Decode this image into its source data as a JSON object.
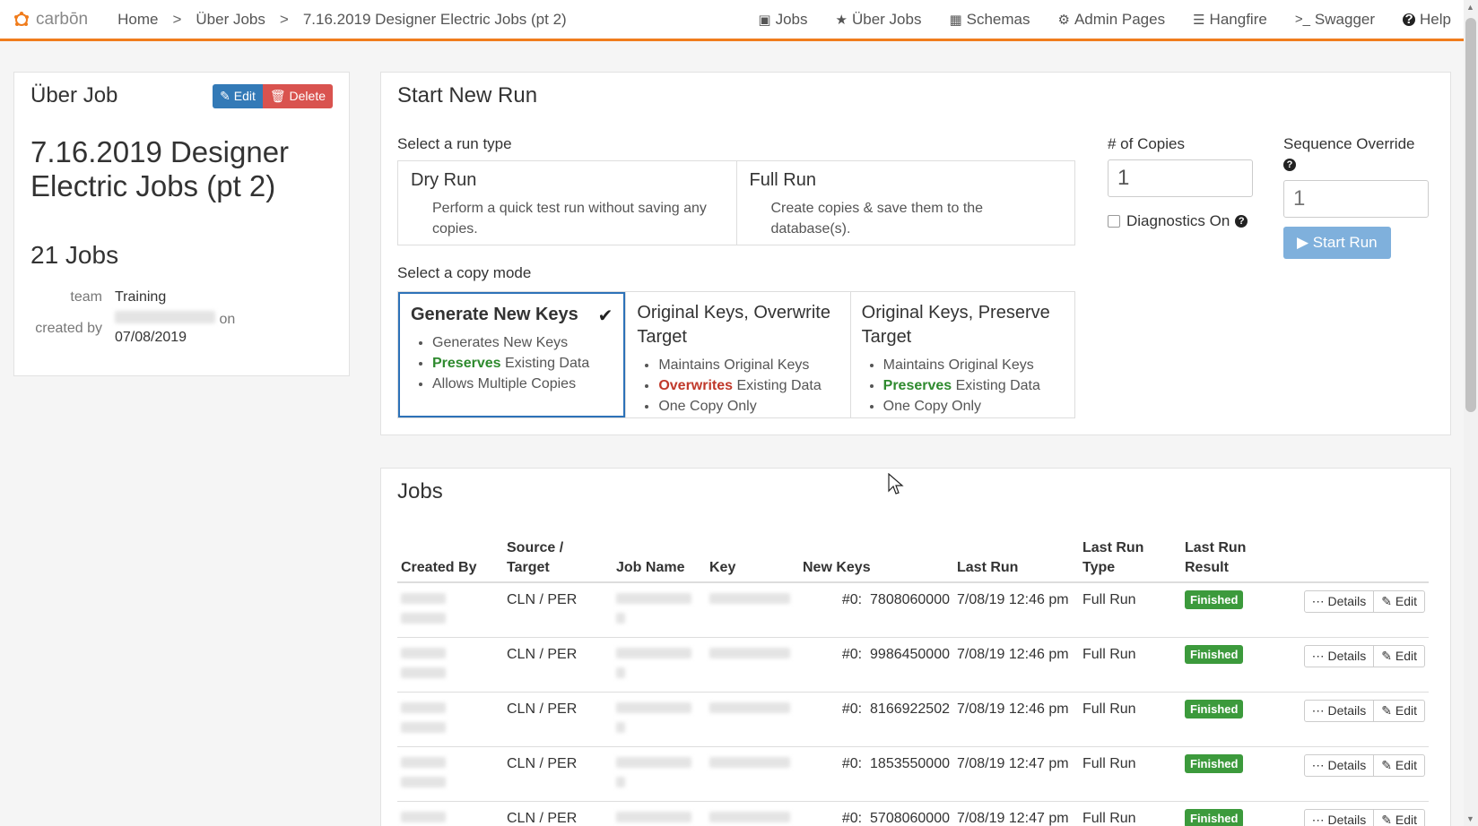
{
  "brand": {
    "name": "carbōn",
    "color": "#f07c1c"
  },
  "breadcrumb": {
    "home": "Home",
    "sep1": ">",
    "uber_jobs": "Über Jobs",
    "sep2": ">",
    "current": "7.16.2019 Designer Electric Jobs (pt 2)"
  },
  "nav": {
    "jobs": "Jobs",
    "uber_jobs": "Über Jobs",
    "schemas": "Schemas",
    "admin_pages": "Admin Pages",
    "hangfire": "Hangfire",
    "swagger_prefix": ">_",
    "swagger": "Swagger",
    "help": "Help"
  },
  "uber_job": {
    "heading": "Über Job",
    "edit_label": "Edit",
    "delete_label": "Delete",
    "title": "7.16.2019 Designer Electric Jobs (pt 2)",
    "jobs_count": "21 Jobs",
    "team_label": "team",
    "team_value": "Training",
    "created_by_label": "created by",
    "on_label": "on",
    "created_date": "07/08/2019"
  },
  "start_run": {
    "heading": "Start New Run",
    "run_type_label": "Select a run type",
    "run_types": [
      {
        "title": "Dry Run",
        "desc": "Perform a quick test run without saving any copies."
      },
      {
        "title": "Full Run",
        "desc": "Create copies & save them to the database(s)."
      }
    ],
    "copy_mode_label": "Select a copy mode",
    "copy_modes": [
      {
        "title": "Generate New Keys",
        "selected": true,
        "items": [
          {
            "pre": "",
            "hl": "",
            "post": "Generates New Keys"
          },
          {
            "pre": "",
            "hl": "Preserves",
            "post": " Existing Data",
            "hl_color": "green"
          },
          {
            "pre": "",
            "hl": "",
            "post": "Allows Multiple Copies"
          }
        ]
      },
      {
        "title": "Original Keys, Overwrite Target",
        "selected": false,
        "items": [
          {
            "pre": "",
            "hl": "",
            "post": "Maintains Original Keys"
          },
          {
            "pre": "",
            "hl": "Overwrites",
            "post": " Existing Data",
            "hl_color": "red"
          },
          {
            "pre": "",
            "hl": "",
            "post": "One Copy Only"
          }
        ]
      },
      {
        "title": "Original Keys, Preserve Target",
        "selected": false,
        "items": [
          {
            "pre": "",
            "hl": "",
            "post": "Maintains Original Keys"
          },
          {
            "pre": "",
            "hl": "Preserves",
            "post": " Existing Data",
            "hl_color": "green"
          },
          {
            "pre": "",
            "hl": "",
            "post": "One Copy Only"
          }
        ]
      }
    ],
    "copies_label": "# of Copies",
    "copies_value": "1",
    "diagnostics_label": "Diagnostics On",
    "sequence_label": "Sequence Override",
    "sequence_placeholder": "1",
    "start_button": "Start Run"
  },
  "jobs": {
    "heading": "Jobs",
    "columns": [
      "Created By",
      "Source / Target",
      "Job Name",
      "Key",
      "New Keys",
      "Last Run",
      "Last Run Type",
      "Last Run Result"
    ],
    "details_label": "Details",
    "edit_label": "Edit",
    "rows": [
      {
        "source_target": "CLN / PER",
        "new_keys_prefix": "#0:",
        "new_keys": "7808060000",
        "last_run": "7/08/19 12:46 pm",
        "run_type": "Full Run",
        "result": "Finished"
      },
      {
        "source_target": "CLN / PER",
        "new_keys_prefix": "#0:",
        "new_keys": "9986450000",
        "last_run": "7/08/19 12:46 pm",
        "run_type": "Full Run",
        "result": "Finished"
      },
      {
        "source_target": "CLN / PER",
        "new_keys_prefix": "#0:",
        "new_keys": "8166922502",
        "last_run": "7/08/19 12:46 pm",
        "run_type": "Full Run",
        "result": "Finished"
      },
      {
        "source_target": "CLN / PER",
        "new_keys_prefix": "#0:",
        "new_keys": "1853550000",
        "last_run": "7/08/19 12:47 pm",
        "run_type": "Full Run",
        "result": "Finished"
      },
      {
        "source_target": "CLN / PER",
        "new_keys_prefix": "#0:",
        "new_keys": "5708060000",
        "last_run": "7/08/19 12:47 pm",
        "run_type": "Full Run",
        "result": "Finished"
      }
    ]
  },
  "colors": {
    "accent": "#f07c1c",
    "primary": "#337ab7",
    "danger": "#d9534f",
    "success": "#3c9a3c"
  }
}
